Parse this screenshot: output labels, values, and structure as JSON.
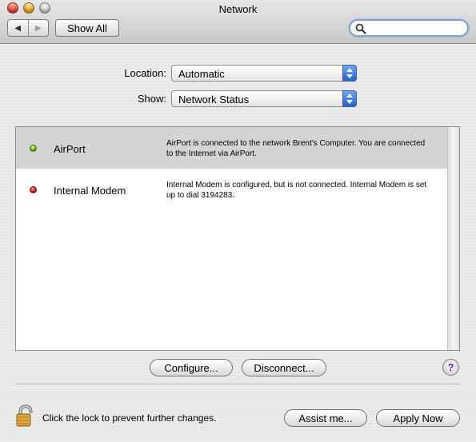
{
  "window": {
    "title": "Network"
  },
  "toolbar": {
    "back_glyph": "◀",
    "forward_glyph": "▶",
    "show_all_label": "Show All",
    "search": {
      "value": "",
      "placeholder": ""
    }
  },
  "settings": {
    "location_label": "Location:",
    "location_value": "Automatic",
    "show_label": "Show:",
    "show_value": "Network Status"
  },
  "status_list": {
    "items": [
      {
        "name": "AirPort",
        "status_color": "#4caf17",
        "description": "AirPort is connected to the network Brent's Computer. You are connected to the Internet via AirPort.",
        "selected": true
      },
      {
        "name": "Internal Modem",
        "status_color": "#c81b1b",
        "description": "Internal Modem is configured, but is not connected. Internal Modem is set up to dial 3194283.",
        "selected": false
      }
    ]
  },
  "actions": {
    "configure_label": "Configure...",
    "disconnect_label": "Disconnect...",
    "help_label": "?"
  },
  "footer": {
    "lock_text": "Click the lock to prevent further changes.",
    "assist_label": "Assist me...",
    "apply_label": "Apply Now"
  },
  "colors": {
    "accent": "#2763c9",
    "search_focus": "#7aa3d8"
  }
}
